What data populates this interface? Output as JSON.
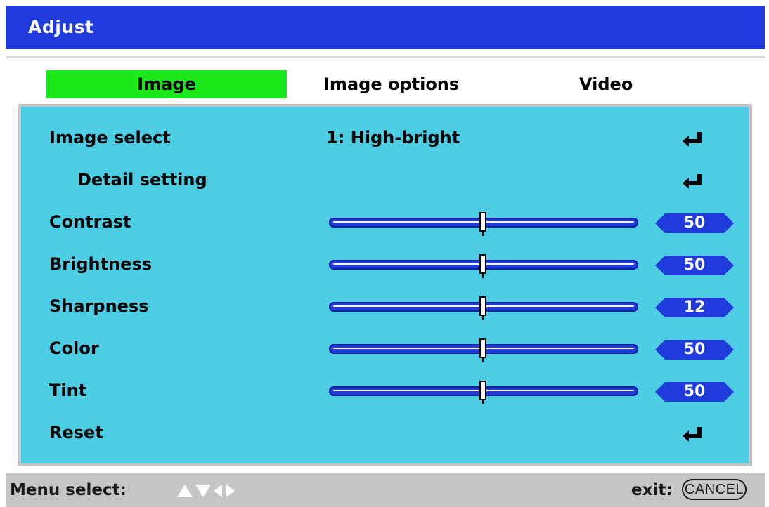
{
  "window": {
    "title": "Adjust"
  },
  "tabs": [
    {
      "label": "Image",
      "active": true
    },
    {
      "label": "Image options",
      "active": false
    },
    {
      "label": "Video",
      "active": false
    }
  ],
  "rows": {
    "image_select": {
      "label": "Image select",
      "value": "1: High-bright"
    },
    "detail_setting": {
      "label": "Detail setting"
    },
    "contrast": {
      "label": "Contrast",
      "value": "50"
    },
    "brightness": {
      "label": "Brightness",
      "value": "50"
    },
    "sharpness": {
      "label": "Sharpness",
      "value": "12"
    },
    "color": {
      "label": "Color",
      "value": "50"
    },
    "tint": {
      "label": "Tint",
      "value": "50"
    },
    "reset": {
      "label": "Reset"
    }
  },
  "footer": {
    "menu_select_label": "Menu select:",
    "exit_label": "exit:",
    "cancel_label": "CANCEL"
  },
  "colors": {
    "title_bar": "#1f3bdc",
    "active_tab": "#1be81b",
    "panel": "#4ccde4",
    "slider": "#1f3bdc",
    "footer": "#c6c6c6"
  }
}
